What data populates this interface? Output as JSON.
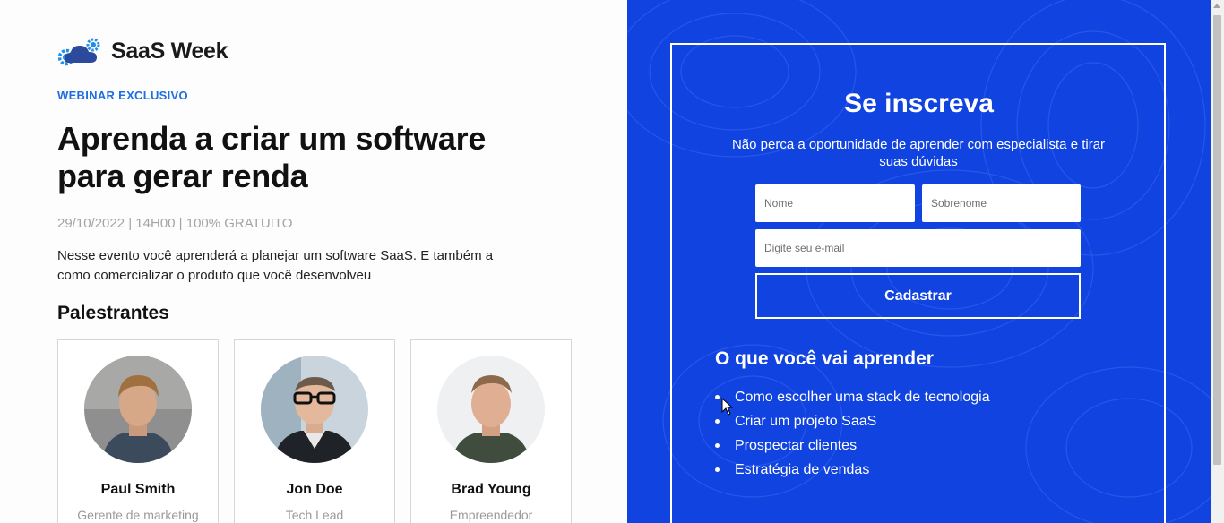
{
  "brand": {
    "name": "SaaS Week"
  },
  "hero": {
    "eyebrow": "WEBINAR EXCLUSIVO",
    "title": "Aprenda a criar um software para gerar renda",
    "meta": "29/10/2022 | 14H00 | 100% GRATUITO",
    "description": "Nesse evento você aprenderá a planejar um software SaaS. E também a como comercializar o produto que você desenvolveu"
  },
  "speakers": {
    "title": "Palestrantes",
    "items": [
      {
        "name": "Paul Smith",
        "role": "Gerente de marketing"
      },
      {
        "name": "Jon Doe",
        "role": "Tech Lead"
      },
      {
        "name": "Brad Young",
        "role": "Empreendedor"
      }
    ]
  },
  "form": {
    "title": "Se inscreva",
    "subtitle": "Não perca a oportunidade de aprender com especialista e tirar suas dúvidas",
    "first_name_placeholder": "Nome",
    "last_name_placeholder": "Sobrenome",
    "email_placeholder": "Digite seu e-mail",
    "submit_label": "Cadastrar"
  },
  "learn": {
    "title": "O que você vai aprender",
    "items": [
      "Como escolher uma stack de tecnologia",
      "Criar um projeto SaaS",
      "Prospectar clientes",
      "Estratégia de vendas"
    ]
  },
  "colors": {
    "accent": "#1f6fe0",
    "panel": "#1143e0"
  }
}
